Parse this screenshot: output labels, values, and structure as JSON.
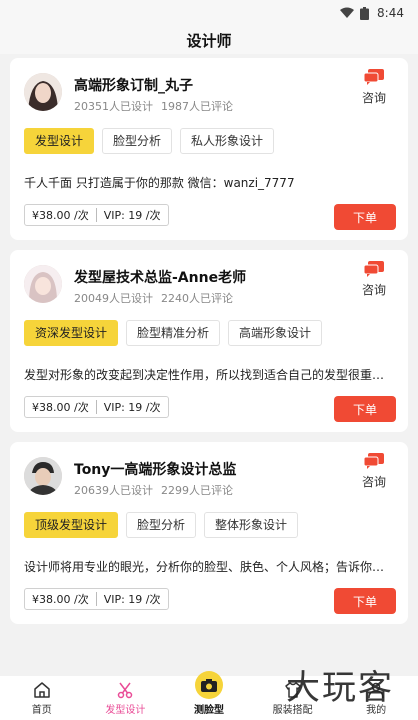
{
  "status_bar": {
    "time": "8:44"
  },
  "header": {
    "title": "设计师"
  },
  "consult_label": "咨询",
  "order_label": "下单",
  "designers": [
    {
      "name": "高端形象订制_丸子",
      "designs": "20351人已设计",
      "comments": "1987人已评论",
      "tags": [
        "发型设计",
        "脸型分析",
        "私人形象设计"
      ],
      "desc": "千人千面 只打造属于你的那款 微信：wanzi_7777",
      "price": "¥38.00 /次",
      "vip": "VIP: 19 /次"
    },
    {
      "name": "发型屋技术总监-Anne老师",
      "designs": "20049人已设计",
      "comments": "2240人已评论",
      "tags": [
        "资深发型设计",
        "脸型精准分析",
        "高端形象设计"
      ],
      "desc": "发型对形象的改变起到决定性作用，所以找到适合自己的发型很重…",
      "price": "¥38.00 /次",
      "vip": "VIP: 19 /次"
    },
    {
      "name": "Tony一高端形象设计总监",
      "designs": "20639人已设计",
      "comments": "2299人已评论",
      "tags": [
        "顶级发型设计",
        "脸型分析",
        "整体形象设计"
      ],
      "desc": "设计师将用专业的眼光，分析你的脸型、肤色、个人风格；告诉你…",
      "price": "¥38.00 /次",
      "vip": "VIP: 19 /次"
    }
  ],
  "tabbar": {
    "items": [
      {
        "label": "首页",
        "icon": "home-icon"
      },
      {
        "label": "发型设计",
        "icon": "scissors-icon"
      },
      {
        "label": "测脸型",
        "icon": "camera-icon"
      },
      {
        "label": "服装搭配",
        "icon": "shirt-icon"
      },
      {
        "label": "我的",
        "icon": "user-icon"
      }
    ]
  },
  "watermark": "大玩客",
  "colors": {
    "accent_yellow": "#f6d43a",
    "order_red": "#f04a34",
    "active_pink": "#e94b96"
  }
}
